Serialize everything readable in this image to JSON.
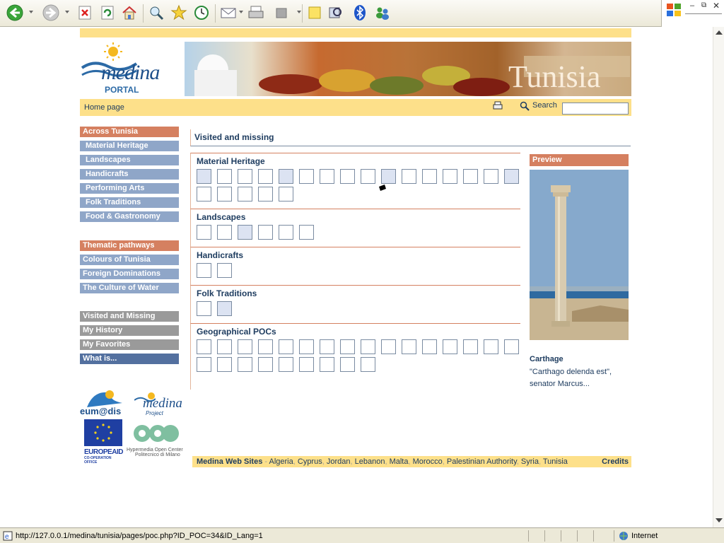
{
  "browser": {
    "status_url": "http://127.0.0.1/medina/tunisia/pages/poc.php?ID_POC=34&ID_Lang=1",
    "zone": "Internet",
    "toolbar_icons": [
      "back-icon",
      "forward-icon",
      "stop-icon",
      "refresh-icon",
      "home-icon",
      "search-icon",
      "favorites-icon",
      "history-icon",
      "mail-icon",
      "print-icon",
      "edit-icon",
      "note-icon",
      "research-icon",
      "bluetooth-icon",
      "messenger-icon"
    ]
  },
  "header": {
    "logo_name": "medina",
    "logo_sub": "PORTAL",
    "banner_text": "Tunisia"
  },
  "navbar": {
    "home": "Home page",
    "search_label": "Search",
    "search_value": ""
  },
  "menu": {
    "group1": [
      "Across Tunisia",
      "Material Heritage",
      "Landscapes",
      "Handicrafts",
      "Performing Arts",
      "Folk Traditions",
      "Food & Gastronomy"
    ],
    "group2": [
      "Thematic pathways",
      "Colours of Tunisia",
      "Foreign Dominations",
      "The Culture of Water"
    ],
    "group3": [
      "Visited and Missing",
      "My History",
      "My Favorites",
      "What is..."
    ]
  },
  "main": {
    "title": "Visited and missing",
    "sections": [
      {
        "name": "Material Heritage",
        "count": 21,
        "visited": [
          0,
          4,
          9,
          15
        ]
      },
      {
        "name": "Landscapes",
        "count": 6,
        "visited": [
          2
        ]
      },
      {
        "name": "Handicrafts",
        "count": 2,
        "visited": []
      },
      {
        "name": "Folk Traditions",
        "count": 2,
        "visited": [
          1
        ]
      },
      {
        "name": "Geographical POCs",
        "count": 25,
        "visited": []
      }
    ]
  },
  "preview": {
    "header": "Preview",
    "caption": "Carthage",
    "description": "\"Carthago delenda est\", senator Marcus..."
  },
  "partners": {
    "eumedis": "eum@dis",
    "medina_project": "medina",
    "medina_project_sub": "Project",
    "europeaid": "EUROPEAID",
    "europeaid_sub": "CO-OPERATION OFFICE",
    "hoc_line1": "Hypermedia Open Center",
    "hoc_line2": "Politecnico di Milano"
  },
  "footer": {
    "label": "Medina Web Sites",
    "dash": " - ",
    "sites": [
      "Algeria",
      "Cyprus",
      "Jordan",
      "Lebanon",
      "Malta",
      "Morocco",
      "Palestinian Authority",
      "Syria",
      "Tunisia"
    ],
    "credits": "Credits"
  },
  "colors": {
    "yellow": "#fde08a",
    "orange": "#d58060",
    "blue_menu": "#8fa6c8",
    "grey_menu": "#9a9a9a",
    "dark_menu": "#53709f",
    "text": "#1f3d60"
  }
}
